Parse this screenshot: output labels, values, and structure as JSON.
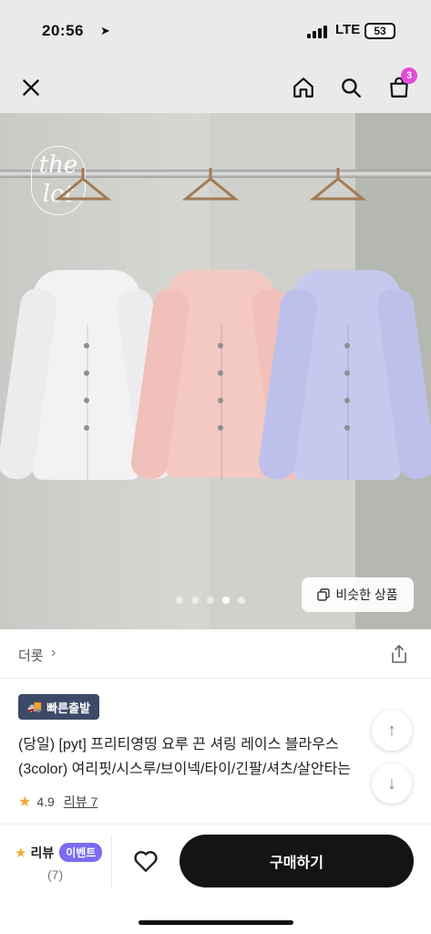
{
  "status": {
    "time": "20:56",
    "network": "LTE",
    "battery": "53"
  },
  "nav": {
    "close_icon": "close-icon",
    "home_icon": "home-icon",
    "search_icon": "search-icon",
    "cart_icon": "cart-icon",
    "cart_count": "3"
  },
  "gallery": {
    "logo_text": "the lot",
    "slide_count": 5,
    "active_slide": 4,
    "similar_button": "비슷한 상품"
  },
  "brand": {
    "name": "더롯",
    "chevron": "›"
  },
  "product": {
    "shipping_tag": "빠른출발",
    "title_line1": "(당일) [pyt] 프리티영띵 요루 끈 셔링 레이스 블라우스",
    "title_line2": "(3color) 여리핏/시스루/브이넥/타이/긴팔/셔츠/살안타는",
    "rating": "4.9",
    "review_link": "리뷰 7"
  },
  "bottom_bar": {
    "review_label": "리뷰",
    "event_badge": "이벤트",
    "review_count": "(7)",
    "buy_button": "구매하기"
  },
  "colors": {
    "accent_badge": "#e04cd8",
    "event_badge": "#7b6cf0",
    "shipping_tag": "#3d4a67",
    "buy_button": "#141414",
    "star": "#f2a93b"
  }
}
